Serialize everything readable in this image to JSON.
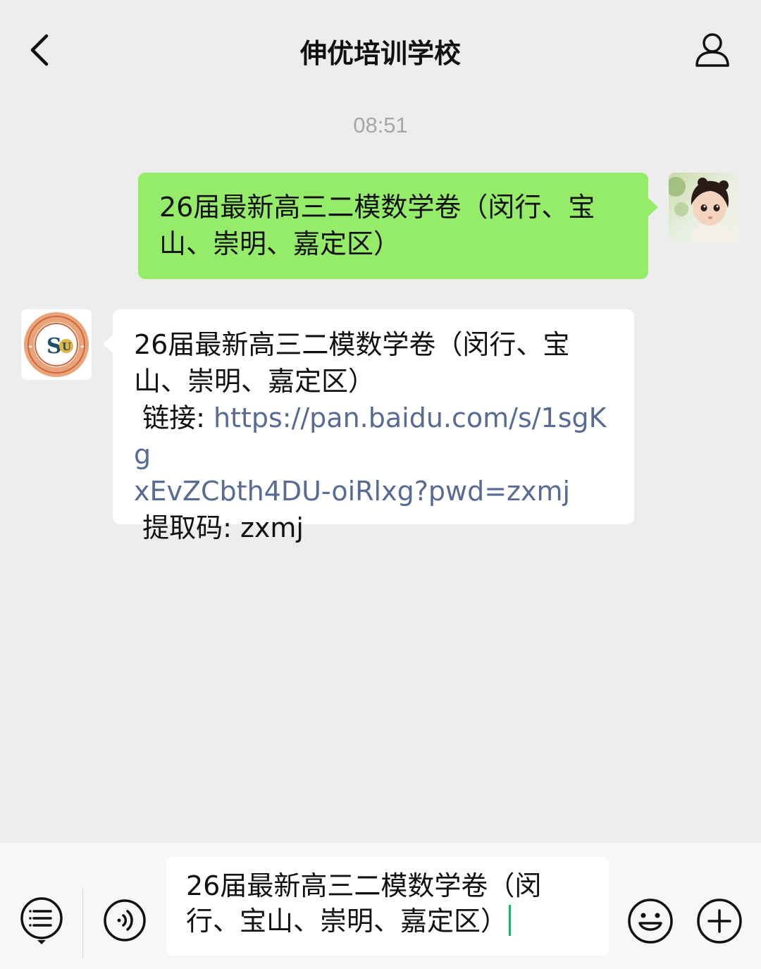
{
  "header": {
    "title": "伸优培训学校",
    "back_icon": "chevron-left-icon",
    "profile_icon": "person-icon"
  },
  "timestamp": "08:51",
  "messages": [
    {
      "direction": "outgoing",
      "avatar": "child-avatar",
      "lines": [
        "26届最新高三二模数学卷（闵行、宝",
        "山、崇明、嘉定区）"
      ],
      "bubble_color": "#95ec69"
    },
    {
      "direction": "incoming",
      "avatar": "school-logo-avatar",
      "title_lines": [
        "26届最新高三二模数学卷（闵行、宝",
        "山、崇明、嘉定区）"
      ],
      "link_label": " 链接: ",
      "link_url_lines": [
        "https://pan.baidu.com/s/1sgKg",
        "xEvZCbth4DU-oiRlxg?pwd=zxmj"
      ],
      "code_line": " 提取码: zxmj",
      "link_color": "#576b95"
    }
  ],
  "input": {
    "lines": [
      "26届最新高三二模数学卷（闵",
      "行、宝山、崇明、嘉定区）"
    ],
    "caret_color": "#07c160"
  },
  "toolbar": {
    "left_icons": [
      "menu-list-icon",
      "voice-icon"
    ],
    "right_icons": [
      "emoji-icon",
      "plus-icon"
    ]
  }
}
